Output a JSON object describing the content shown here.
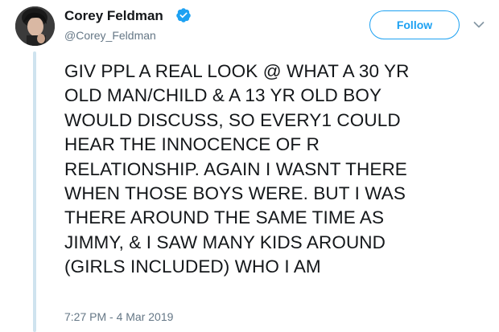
{
  "tweet": {
    "author": {
      "display_name": "Corey Feldman",
      "handle": "@Corey_Feldman",
      "verified": true,
      "avatar_icon": "user-avatar-photo"
    },
    "follow_button_label": "Follow",
    "menu_icon": "chevron-down-icon",
    "text_lines": [
      "GIV PPL A REAL LOOK @ WHAT A 30 YR",
      "OLD MAN/CHILD & A 13 YR OLD BOY",
      "WOULD DISCUSS, SO EVERY1 COULD",
      "HEAR THE INNOCENCE OF R",
      "RELATIONSHIP. AGAIN I WASNT THERE",
      "WHEN THOSE BOYS WERE. BUT I WAS",
      "THERE AROUND THE SAME TIME AS",
      "JIMMY, & I SAW MANY KIDS AROUND",
      "(GIRLS INCLUDED) WHO I AM"
    ],
    "timestamp": "7:27 PM - 4 Mar 2019"
  },
  "colors": {
    "accent": "#1da1f2",
    "text": "#14171a",
    "secondary_text": "#657786",
    "thread_line": "#cfe3ef"
  }
}
